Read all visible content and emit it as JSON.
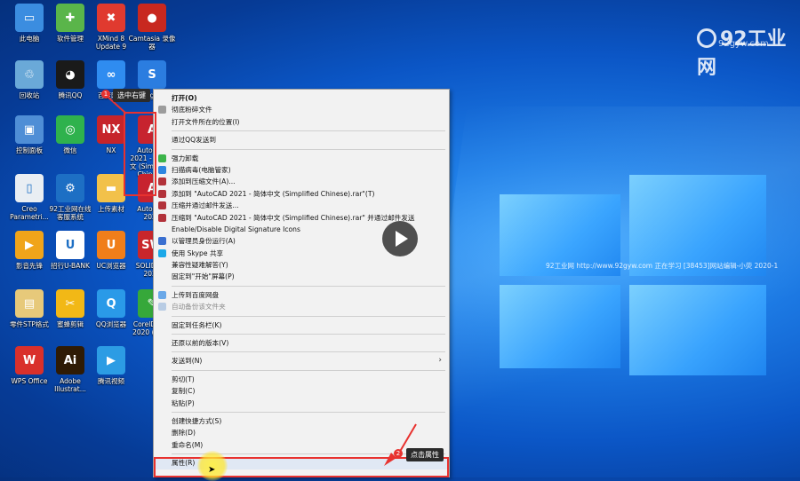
{
  "watermark": {
    "logo": "92工业网",
    "sub": "92gyw.com",
    "line": "92工业网 http://www.92gyw.com 正在学习 [38453]网站编辑-小荧 2020-1"
  },
  "desktop_icons": [
    {
      "label": "此电脑",
      "icon": "computer-icon",
      "color": "#3b8de0",
      "glyph": "▭"
    },
    {
      "label": "软件管理",
      "icon": "software-manager-icon",
      "color": "#5ab54a",
      "glyph": "✚"
    },
    {
      "label": "XMind 8 Update 9",
      "icon": "xmind-icon",
      "color": "#e03a2f",
      "glyph": "✖"
    },
    {
      "label": "Camtasia 录像器",
      "icon": "camtasia-icon",
      "color": "#c8281f",
      "glyph": "●"
    },
    {
      "label": "回收站",
      "icon": "recycle-bin-icon",
      "color": "#6aa9d8",
      "glyph": "♲"
    },
    {
      "label": "腾讯QQ",
      "icon": "qq-icon",
      "color": "#1a1a1a",
      "glyph": "◕"
    },
    {
      "label": "百度网盘",
      "icon": "baidu-netdisk-icon",
      "color": "#2f8cf0",
      "glyph": "∞"
    },
    {
      "label": "Sogou",
      "icon": "sogou-icon",
      "color": "#2b7de0",
      "glyph": "S"
    },
    {
      "label": "控制面板",
      "icon": "control-panel-icon",
      "color": "#4f8ed6",
      "glyph": "▣"
    },
    {
      "label": "微信",
      "icon": "wechat-icon",
      "color": "#2fb24d",
      "glyph": "◎"
    },
    {
      "label": "NX",
      "icon": "nx-icon",
      "color": "#c6242a",
      "glyph": "NX"
    },
    {
      "label": "AutoCAD 2021 - 简体中文 (Simplified Chinese)",
      "icon": "autocad-icon",
      "color": "#c7232f",
      "glyph": "A"
    },
    {
      "label": "Creo Parametri...",
      "icon": "creo-icon",
      "color": "#e9eef3",
      "glyph": "▯"
    },
    {
      "label": "92工业网在线客服系统",
      "icon": "gear-service-icon",
      "color": "#1d6fc4",
      "glyph": "⚙"
    },
    {
      "label": "上传素材",
      "icon": "folder-icon",
      "color": "#f2c14a",
      "glyph": "▬"
    },
    {
      "label": "AutoCAD 2020",
      "icon": "autocad2020-icon",
      "color": "#c7232f",
      "glyph": "A"
    },
    {
      "label": "影音先锋",
      "icon": "player-icon",
      "color": "#f0a41a",
      "glyph": "▶"
    },
    {
      "label": "招行U-BANK",
      "icon": "ubank-icon",
      "color": "#ffffff",
      "glyph": "U"
    },
    {
      "label": "UC浏览器",
      "icon": "uc-browser-icon",
      "color": "#f07e1a",
      "glyph": "U"
    },
    {
      "label": "SOLIDW... 2020",
      "icon": "solidworks-icon",
      "color": "#c9262b",
      "glyph": "SW"
    },
    {
      "label": "零件STP格式",
      "icon": "stp-file-icon",
      "color": "#e7c97a",
      "glyph": "▤"
    },
    {
      "label": "蜜蜂剪辑",
      "icon": "bee-editor-icon",
      "color": "#f2b816",
      "glyph": "✂"
    },
    {
      "label": "QQ浏览器",
      "icon": "qq-browser-icon",
      "color": "#2a9ae8",
      "glyph": "Q"
    },
    {
      "label": "CorelDRAW 2020 (64-...",
      "icon": "coreldraw-icon",
      "color": "#36a83a",
      "glyph": "✎"
    },
    {
      "label": "WPS Office",
      "icon": "wps-icon",
      "color": "#d9302b",
      "glyph": "W"
    },
    {
      "label": "Adobe Illustrat...",
      "icon": "illustrator-icon",
      "color": "#2f1b05",
      "glyph": "Ai"
    },
    {
      "label": "腾讯视频",
      "icon": "tencent-video-icon",
      "color": "#2c9ce4",
      "glyph": "▶"
    }
  ],
  "context_menu": [
    {
      "type": "item",
      "label": "打开(O)",
      "bold": true
    },
    {
      "type": "item",
      "label": "彻底粉碎文件",
      "icon": "shred-icon",
      "icolor": "#9c9c9c"
    },
    {
      "type": "item",
      "label": "打开文件所在的位置(I)"
    },
    {
      "type": "sep"
    },
    {
      "type": "item",
      "label": "通过QQ发送到"
    },
    {
      "type": "sep"
    },
    {
      "type": "item",
      "label": "强力卸载",
      "icon": "uninstall-icon",
      "icolor": "#3cb44a"
    },
    {
      "type": "item",
      "label": "扫描病毒(电脑管家)",
      "icon": "shield-icon",
      "icolor": "#2d86e0"
    },
    {
      "type": "item",
      "label": "添加到压缩文件(A)...",
      "icon": "winrar-icon",
      "icolor": "#b2323a"
    },
    {
      "type": "item",
      "label": "添加到 \"AutoCAD 2021 - 简体中文 (Simplified Chinese).rar\"(T)",
      "icon": "winrar-icon",
      "icolor": "#b2323a"
    },
    {
      "type": "item",
      "label": "压缩并通过邮件发送...",
      "icon": "winrar-icon",
      "icolor": "#b2323a"
    },
    {
      "type": "item",
      "label": "压缩到 \"AutoCAD 2021 - 简体中文 (Simplified Chinese).rar\" 并通过邮件发送",
      "icon": "winrar-icon",
      "icolor": "#b2323a"
    },
    {
      "type": "item",
      "label": "Enable/Disable Digital Signature Icons"
    },
    {
      "type": "item",
      "label": "以管理员身份运行(A)",
      "icon": "uac-shield-icon",
      "icolor": "#3a6fd0"
    },
    {
      "type": "item",
      "label": "使用 Skype 共享",
      "icon": "skype-icon",
      "icolor": "#1ba8e8"
    },
    {
      "type": "item",
      "label": "兼容性疑难解答(Y)"
    },
    {
      "type": "item",
      "label": "固定到\"开始\"屏幕(P)"
    },
    {
      "type": "sep"
    },
    {
      "type": "item",
      "label": "上传到百度网盘",
      "icon": "baidu-cloud-icon",
      "icolor": "#6aa8e8"
    },
    {
      "type": "item",
      "label": "自动备份该文件夹",
      "icon": "baidu-cloud-icon",
      "icolor": "#b8cce4",
      "disabled": true
    },
    {
      "type": "sep"
    },
    {
      "type": "item",
      "label": "固定到任务栏(K)"
    },
    {
      "type": "sep"
    },
    {
      "type": "item",
      "label": "还原以前的版本(V)"
    },
    {
      "type": "sep"
    },
    {
      "type": "item",
      "label": "发送到(N)",
      "submenu": true
    },
    {
      "type": "sep"
    },
    {
      "type": "item",
      "label": "剪切(T)"
    },
    {
      "type": "item",
      "label": "复制(C)"
    },
    {
      "type": "item",
      "label": "粘贴(P)"
    },
    {
      "type": "sep"
    },
    {
      "type": "item",
      "label": "创建快捷方式(S)"
    },
    {
      "type": "item",
      "label": "删除(D)"
    },
    {
      "type": "item",
      "label": "重命名(M)"
    },
    {
      "type": "sep"
    },
    {
      "type": "item",
      "label": "属性(R)",
      "highlight": true
    }
  ],
  "annotations": {
    "step1_num": "1",
    "step1_text": "选中右键",
    "step2_num": "2",
    "step2_text": "点击属性",
    "accent": "#e8322f"
  }
}
